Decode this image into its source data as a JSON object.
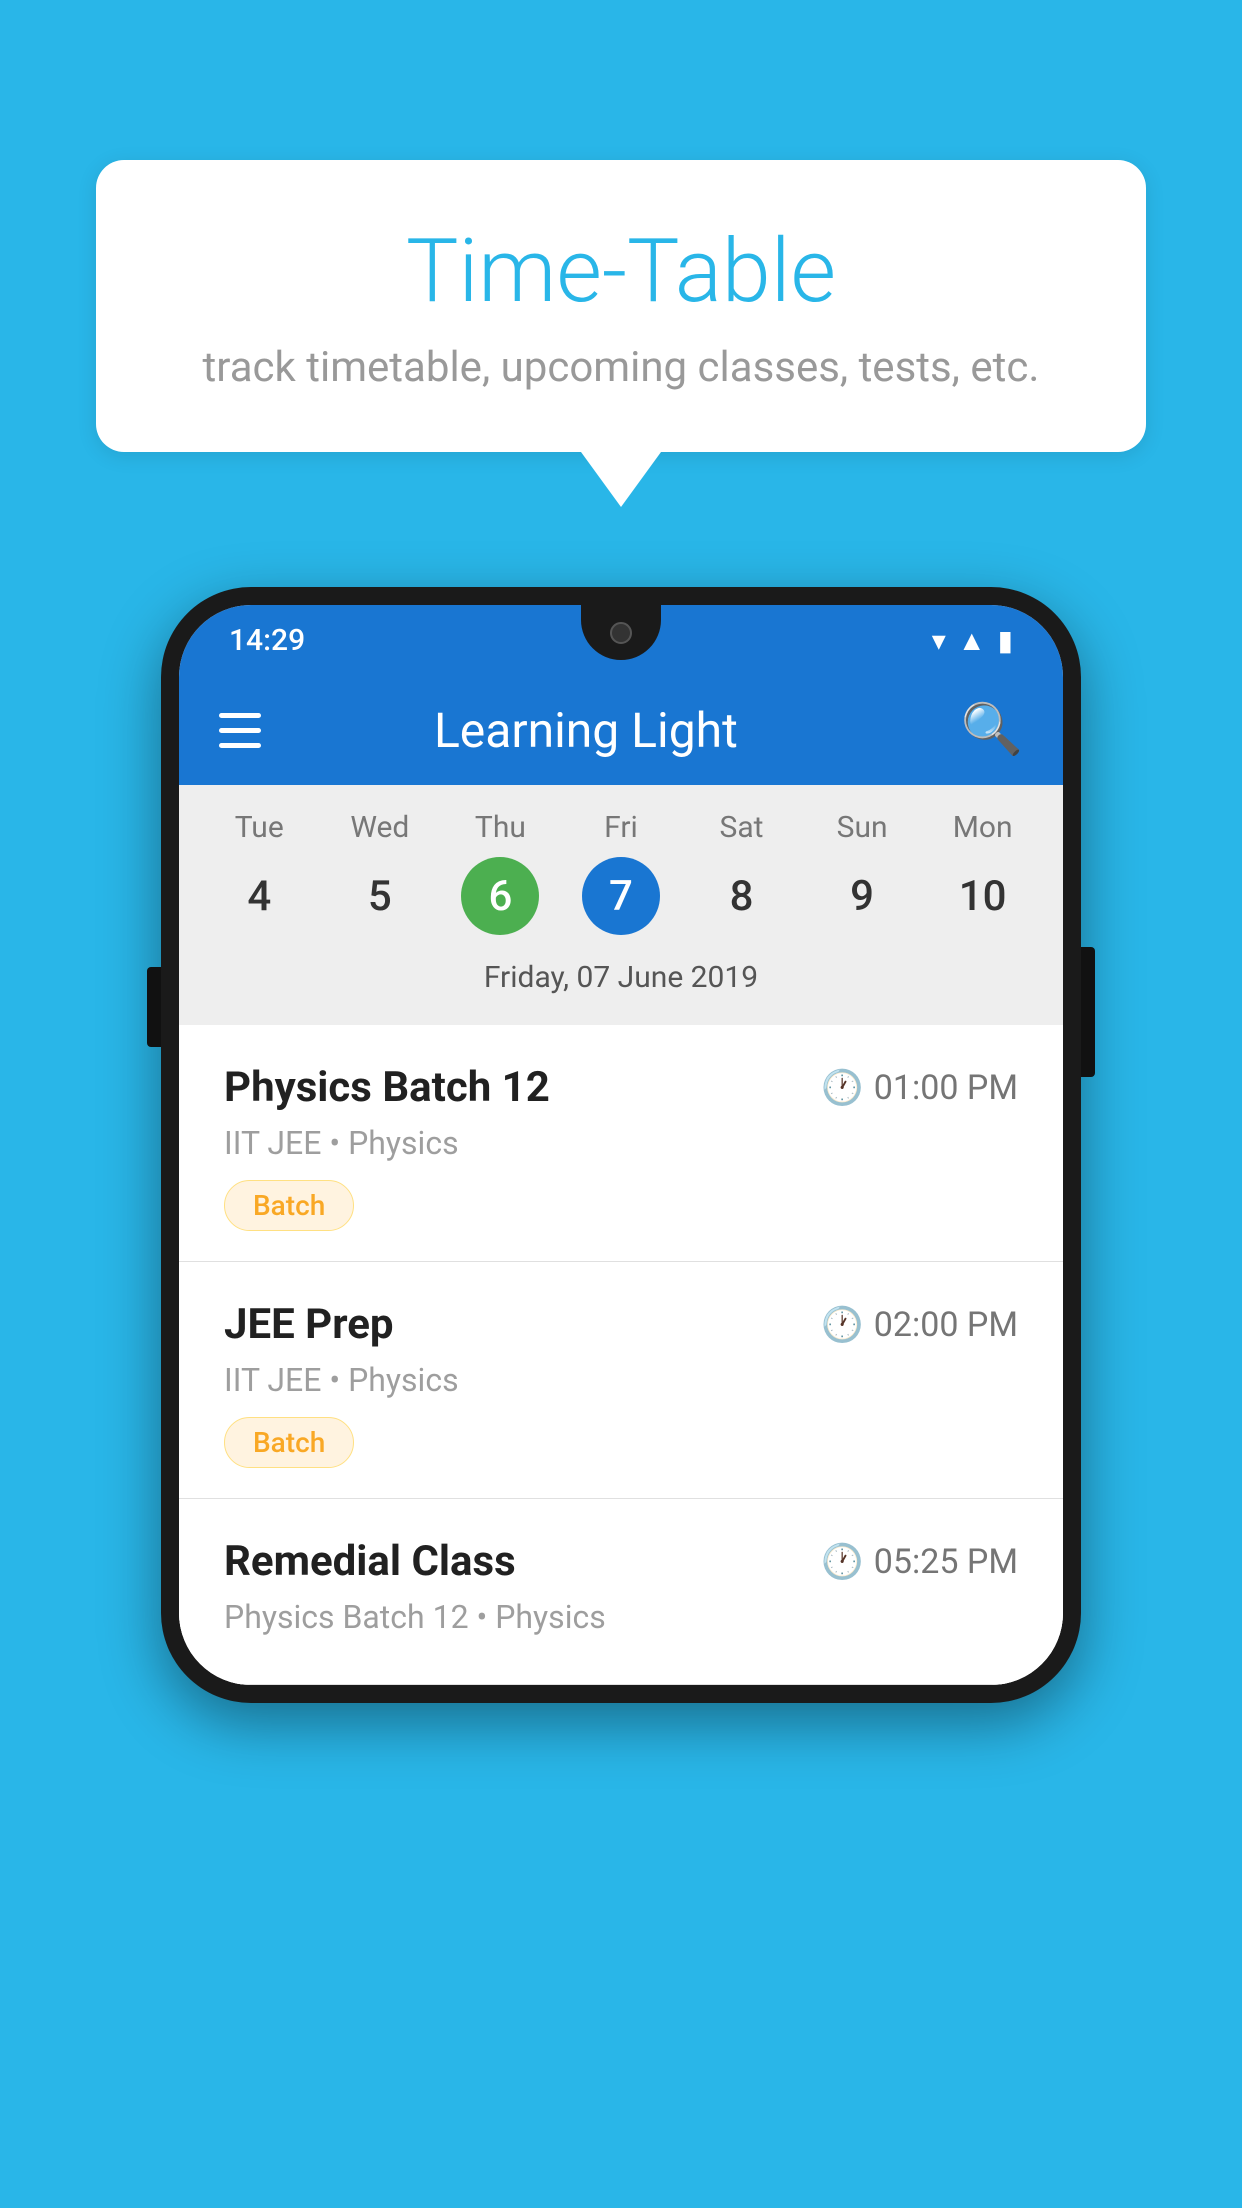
{
  "background_color": "#29b6e8",
  "speech_bubble": {
    "title": "Time-Table",
    "subtitle": "track timetable, upcoming classes, tests, etc."
  },
  "phone": {
    "status_bar": {
      "time": "14:29"
    },
    "app_bar": {
      "title": "Learning Light",
      "menu_icon": "hamburger-icon",
      "search_icon": "search-icon"
    },
    "calendar": {
      "days": [
        {
          "label": "Tue",
          "number": "4",
          "state": "normal"
        },
        {
          "label": "Wed",
          "number": "5",
          "state": "normal"
        },
        {
          "label": "Thu",
          "number": "6",
          "state": "today"
        },
        {
          "label": "Fri",
          "number": "7",
          "state": "selected"
        },
        {
          "label": "Sat",
          "number": "8",
          "state": "normal"
        },
        {
          "label": "Sun",
          "number": "9",
          "state": "normal"
        },
        {
          "label": "Mon",
          "number": "10",
          "state": "normal"
        }
      ],
      "selected_date_label": "Friday, 07 June 2019"
    },
    "schedule": [
      {
        "title": "Physics Batch 12",
        "time": "01:00 PM",
        "subtitle": "IIT JEE • Physics",
        "badge": "Batch"
      },
      {
        "title": "JEE Prep",
        "time": "02:00 PM",
        "subtitle": "IIT JEE • Physics",
        "badge": "Batch"
      },
      {
        "title": "Remedial Class",
        "time": "05:25 PM",
        "subtitle": "Physics Batch 12 • Physics",
        "badge": null
      }
    ]
  }
}
